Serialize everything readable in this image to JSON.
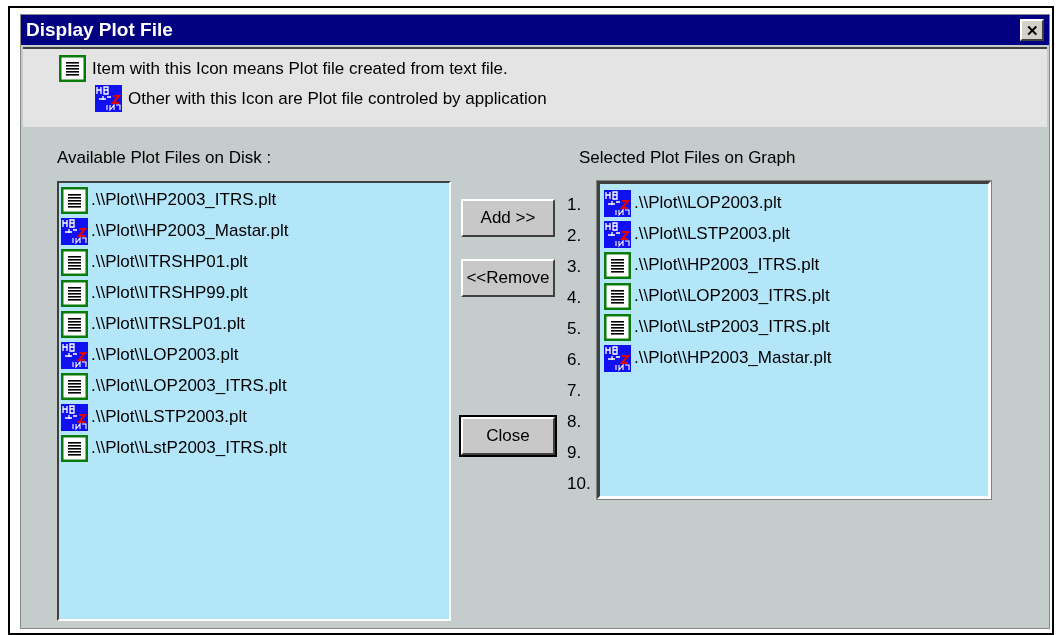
{
  "window": {
    "title": "Display Plot File",
    "close": "✕"
  },
  "legend": [
    {
      "kind": "text",
      "label": "Item with this Icon means Plot file created from text file."
    },
    {
      "kind": "app",
      "label": "Other with this Icon are Plot file controled by application"
    }
  ],
  "available": {
    "label": "Available Plot Files on Disk :",
    "items": [
      {
        "kind": "text",
        "name": ".\\\\Plot\\\\HP2003_ITRS.plt"
      },
      {
        "kind": "app",
        "name": ".\\\\Plot\\\\HP2003_Mastar.plt"
      },
      {
        "kind": "text",
        "name": ".\\\\Plot\\\\ITRSHP01.plt"
      },
      {
        "kind": "text",
        "name": ".\\\\Plot\\\\ITRSHP99.plt"
      },
      {
        "kind": "text",
        "name": ".\\\\Plot\\\\ITRSLP01.plt"
      },
      {
        "kind": "app",
        "name": ".\\\\Plot\\\\LOP2003.plt"
      },
      {
        "kind": "text",
        "name": ".\\\\Plot\\\\LOP2003_ITRS.plt"
      },
      {
        "kind": "app",
        "name": ".\\\\Plot\\\\LSTP2003.plt"
      },
      {
        "kind": "text",
        "name": ".\\\\Plot\\\\LstP2003_ITRS.plt"
      }
    ]
  },
  "buttons": [
    {
      "label": "Add >>",
      "default": false
    },
    {
      "label": "<<Remove",
      "default": false
    },
    {
      "label": "Close",
      "default": true
    }
  ],
  "selected": {
    "label": "Selected Plot Files on Graph",
    "numbers": [
      "1.",
      "2.",
      "3.",
      "4.",
      "5.",
      "6.",
      "7.",
      "8.",
      "9.",
      "10."
    ],
    "items": [
      {
        "kind": "app",
        "name": ".\\\\Plot\\\\LOP2003.plt"
      },
      {
        "kind": "app",
        "name": ".\\\\Plot\\\\LSTP2003.plt"
      },
      {
        "kind": "text",
        "name": ".\\\\Plot\\\\HP2003_ITRS.plt"
      },
      {
        "kind": "text",
        "name": ".\\\\Plot\\\\LOP2003_ITRS.plt"
      },
      {
        "kind": "text",
        "name": ".\\\\Plot\\\\LstP2003_ITRS.plt"
      },
      {
        "kind": "app",
        "name": ".\\\\Plot\\\\HP2003_Mastar.plt"
      }
    ]
  }
}
